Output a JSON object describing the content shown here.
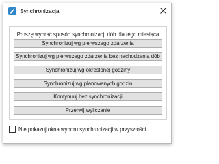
{
  "window": {
    "title": "Synchronizacja"
  },
  "prompt": "Proszę wybrać sposób synchronizacji dób dla tego miesiąca",
  "buttons": [
    {
      "label": "Synchronizuj wg pierwszego zdarzenia"
    },
    {
      "label": "Synchronizuj wg pierwszego zdarzenia bez nachodzenia dób"
    },
    {
      "label": "Synchronizuj wg określonej godziny"
    },
    {
      "label": "Synchronizuj wg planowanych godzin"
    },
    {
      "label": "Kontynuuj bez synchronizacji"
    },
    {
      "label": "Przerwij wyliczanie"
    }
  ],
  "footer": {
    "checkbox_label": "Nie pokazuj okna wyboru synchronizacji w przyszłości",
    "checked": false
  },
  "icons": {
    "app": "app-logo-icon",
    "close": "close-icon"
  }
}
